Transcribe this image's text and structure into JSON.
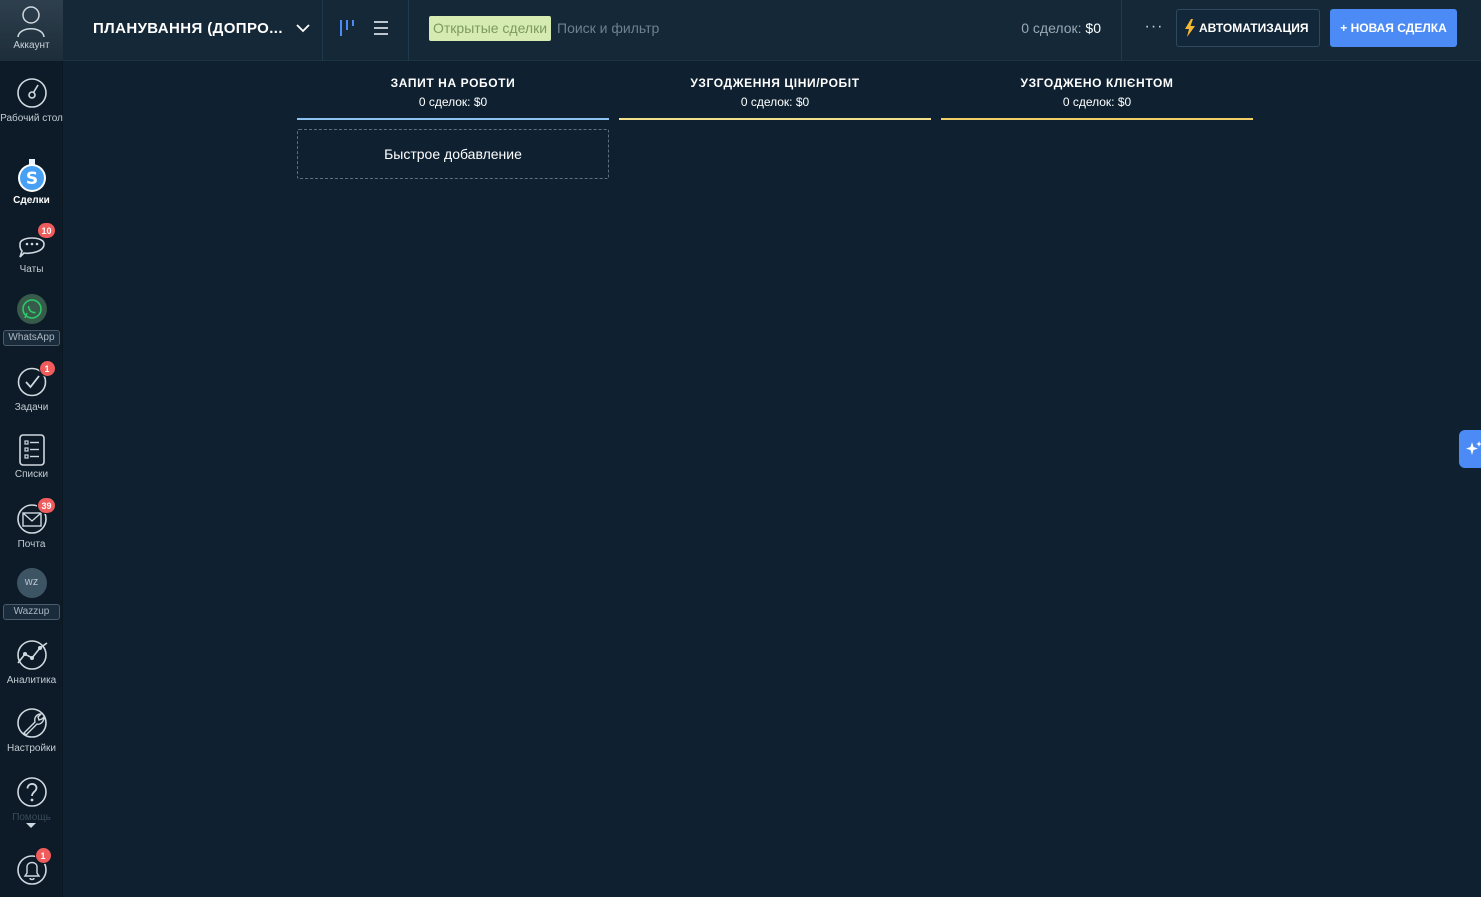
{
  "sidebar": {
    "account_label": "Аккаунт",
    "items": [
      {
        "label": "Рабочий стол",
        "icon": "dashboard-icon",
        "badge": ""
      },
      {
        "label": "Сделки",
        "icon": "deals-dollar-icon",
        "badge": ""
      },
      {
        "label": "Чаты",
        "icon": "chat-icon",
        "badge": "10"
      },
      {
        "label": "WhatsApp",
        "icon": "whatsapp-icon",
        "badge": ""
      },
      {
        "label": "Задачи",
        "icon": "tasks-check-icon",
        "badge": "1"
      },
      {
        "label": "Списки",
        "icon": "lists-icon",
        "badge": ""
      },
      {
        "label": "Почта",
        "icon": "mail-icon",
        "badge": "39"
      },
      {
        "label": "Wazzup",
        "icon": "wazzup-icon",
        "icon_text": "wz",
        "badge": ""
      },
      {
        "label": "Аналитика",
        "icon": "analytics-icon",
        "badge": ""
      },
      {
        "label": "Настройки",
        "icon": "settings-wrench-icon",
        "badge": ""
      },
      {
        "label": "Помощь",
        "icon": "help-question-icon",
        "badge": ""
      },
      {
        "label": "",
        "icon": "notifications-bell-icon",
        "badge": "1"
      }
    ]
  },
  "header": {
    "pipeline_title": "ПЛАНУВАННЯ (ДОПРО...",
    "filter_chip": "Открытые сделки",
    "search_placeholder": "Поиск и фильтр",
    "deals_count_label": "0 сделок:",
    "deals_amount": "$0",
    "more_label": "···",
    "automation_label": "АВТОМАТИЗАЦИЯ",
    "new_deal_label": "+ НОВАЯ СДЕЛКА"
  },
  "board": {
    "columns": [
      {
        "name": "ЗАПИТ НА РОБОТИ",
        "count": "0 сделок: $0",
        "color": "#8cc1f0"
      },
      {
        "name": "УЗГОДЖЕННЯ ЦІНИ/РОБІТ",
        "count": "0 сделок: $0",
        "color": "#f3e08a"
      },
      {
        "name": "УЗГОДЖЕНО КЛІЄНТОМ",
        "count": "0 сделок: $0",
        "color": "#f2cf68"
      }
    ],
    "quick_add_label": "Быстрое добавление"
  },
  "colors": {
    "background": "#0f2130",
    "accent": "#4c8bf5",
    "badge": "#f05b5b"
  }
}
